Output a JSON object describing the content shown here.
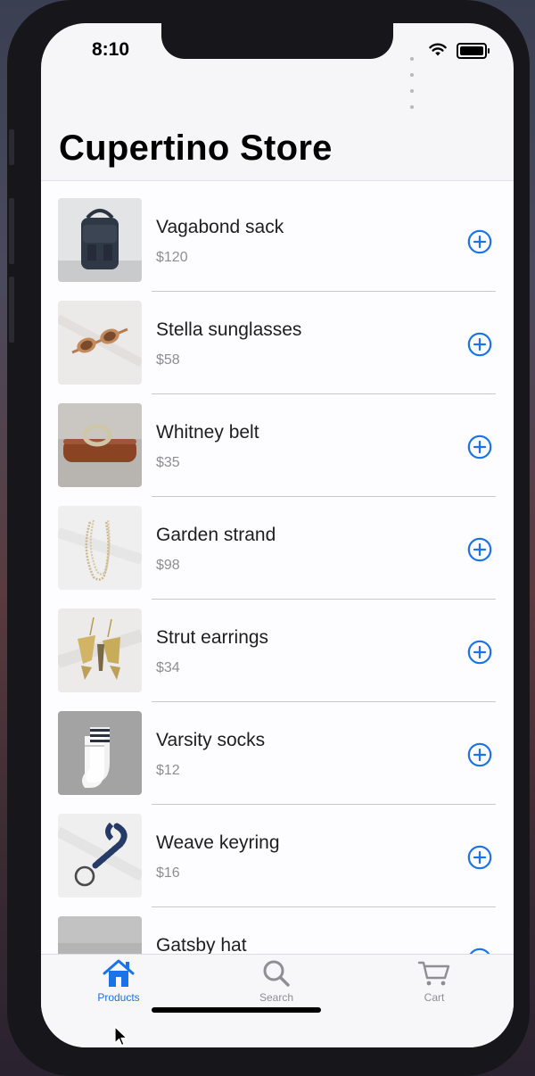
{
  "status_bar": {
    "time": "8:10"
  },
  "nav": {
    "title": "Cupertino Store"
  },
  "products": [
    {
      "name": "Vagabond sack",
      "price": "$120",
      "icon": "backpack-photo"
    },
    {
      "name": "Stella sunglasses",
      "price": "$58",
      "icon": "sunglasses-photo"
    },
    {
      "name": "Whitney belt",
      "price": "$35",
      "icon": "belt-photo"
    },
    {
      "name": "Garden strand",
      "price": "$98",
      "icon": "necklace-photo"
    },
    {
      "name": "Strut earrings",
      "price": "$34",
      "icon": "earrings-photo"
    },
    {
      "name": "Varsity socks",
      "price": "$12",
      "icon": "socks-photo"
    },
    {
      "name": "Weave keyring",
      "price": "$16",
      "icon": "keyring-photo"
    },
    {
      "name": "Gatsby hat",
      "price": "",
      "icon": "hat-photo"
    }
  ],
  "tabbar": {
    "tabs": [
      {
        "label": "Products",
        "icon": "home-icon",
        "active": true
      },
      {
        "label": "Search",
        "icon": "search-icon",
        "active": false
      },
      {
        "label": "Cart",
        "icon": "cart-icon",
        "active": false
      }
    ]
  },
  "colors": {
    "accent": "#1a73e8",
    "inactive": "#8e8e93"
  }
}
